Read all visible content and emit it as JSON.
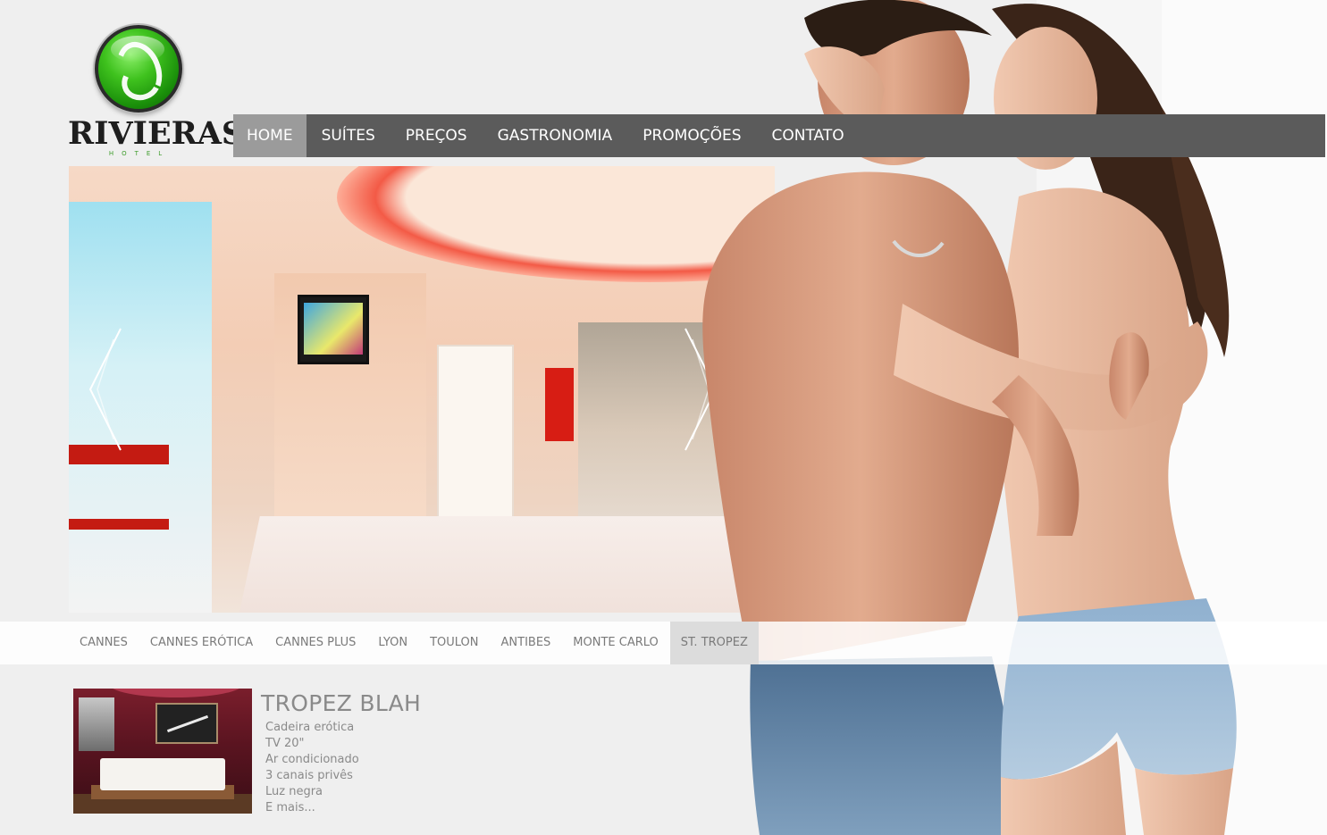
{
  "logo": {
    "name": "RIVIERAS",
    "subtitle": "HOTEL"
  },
  "nav": {
    "items": [
      {
        "label": "HOME",
        "active": true
      },
      {
        "label": "SUÍTES",
        "active": false
      },
      {
        "label": "PREÇOS",
        "active": false
      },
      {
        "label": "GASTRONOMIA",
        "active": false
      },
      {
        "label": "PROMOÇÕES",
        "active": false
      },
      {
        "label": "CONTATO",
        "active": false
      }
    ]
  },
  "slider": {
    "prev_icon": "chevron-left-icon",
    "next_icon": "chevron-right-icon"
  },
  "suites": {
    "tabs": [
      {
        "label": "CANNES",
        "active": false
      },
      {
        "label": "CANNES ERÓTICA",
        "active": false
      },
      {
        "label": "CANNES PLUS",
        "active": false
      },
      {
        "label": "LYON",
        "active": false
      },
      {
        "label": "TOULON",
        "active": false
      },
      {
        "label": "ANTIBES",
        "active": false
      },
      {
        "label": "MONTE CARLO",
        "active": false
      },
      {
        "label": "ST. TROPEZ",
        "active": true
      }
    ],
    "detail": {
      "title": "TROPEZ BLAH",
      "features": [
        "Cadeira erótica",
        "TV 20\"",
        "Ar condicionado",
        "3 canais privês",
        "Luz negra",
        "E mais..."
      ]
    }
  },
  "colors": {
    "nav_bg": "#5b5b5b",
    "nav_active": "#9b9b9b",
    "logo_green": "#3fc21e",
    "page_bg": "#efefef"
  }
}
